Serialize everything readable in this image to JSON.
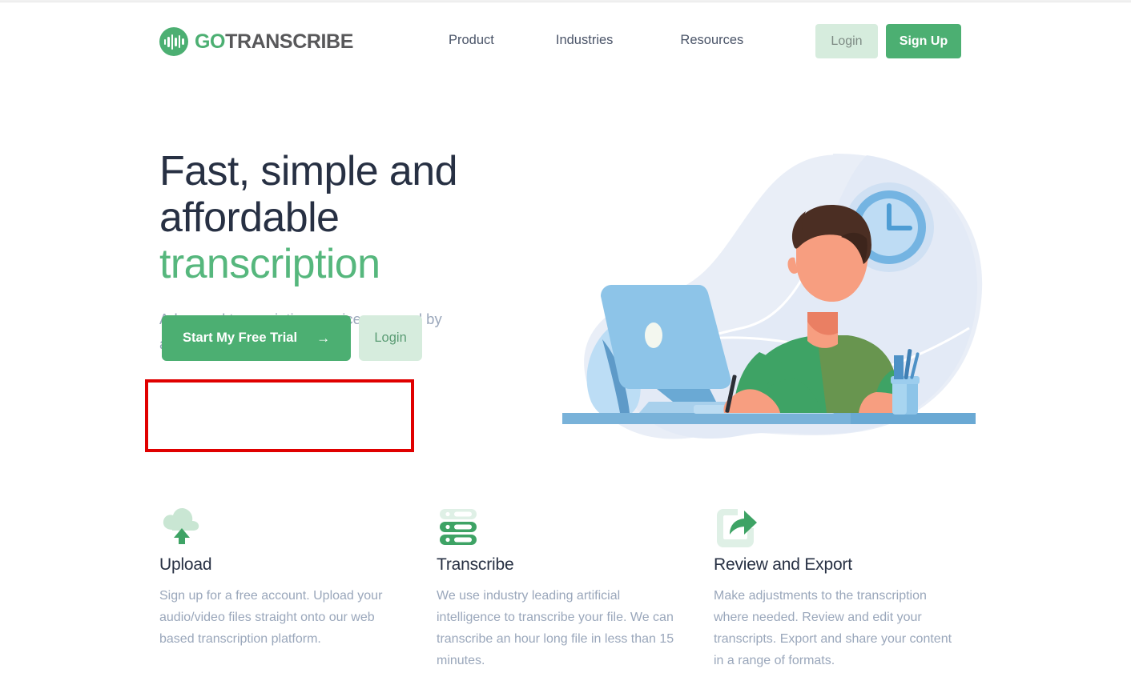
{
  "brand": {
    "logo_go": "GO",
    "logo_transcribe": "TRANSCRIBE",
    "logo_icon": "waveform-icon",
    "accent_green": "#4caf72",
    "light_green": "#d6ecdd",
    "heading_navy": "#273043",
    "body_grey": "#9aa7bb"
  },
  "header": {
    "nav": [
      {
        "label": "Product"
      },
      {
        "label": "Industries"
      },
      {
        "label": "Resources"
      }
    ],
    "login_label": "Login",
    "signup_label": "Sign Up"
  },
  "hero": {
    "title_line1": "Fast, simple and",
    "title_line2": "affordable",
    "title_accent": "transcription",
    "subtitle": "Advanced transcription service powered by artificial intelligence.",
    "cta_primary": "Start My Free Trial",
    "cta_primary_icon": "arrow-right-icon",
    "cta_primary_arrow": "→",
    "cta_secondary": "Login",
    "illustration": "man-at-desk-with-computer-and-clock-illustration"
  },
  "annotation": {
    "color": "#e00000",
    "target": "hero-cta-buttons"
  },
  "features": [
    {
      "icon": "cloud-upload-icon",
      "title": "Upload",
      "text": "Sign up for a free account. Upload your audio/video files straight onto our web based transcription platform."
    },
    {
      "icon": "server-stack-icon",
      "title": "Transcribe",
      "text": "We use industry leading artificial intelligence to transcribe your file. We can transcribe an hour long file in less than 15 minutes."
    },
    {
      "icon": "share-export-icon",
      "title": "Review and Export",
      "text": "Make adjustments to the transcription where needed. Review and edit your transcripts. Export and share your content in a range of formats."
    }
  ]
}
